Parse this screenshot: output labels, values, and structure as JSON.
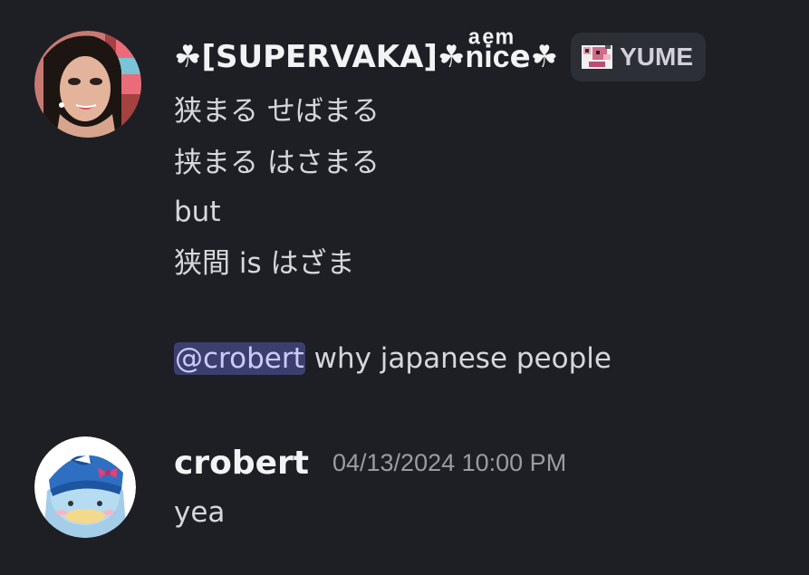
{
  "messages": [
    {
      "username": "☘[SUPERVAKA]☘nͣiͤcͫe☘",
      "role_tag": "YUME",
      "lines": [
        "狭まる せばまる",
        "挟まる はさまる",
        "but",
        "狭間 is はざま"
      ],
      "mention": "@crobert",
      "mention_text": " why japanese people"
    },
    {
      "username": "crobert",
      "timestamp": "04/13/2024 10:00 PM",
      "lines": [
        "yea"
      ]
    }
  ],
  "icons": {
    "role_icon": "pixel-pig-icon",
    "avatar1": "avatar-photo",
    "avatar2": "avatar-penguin"
  },
  "colors": {
    "background": "#1e1f24",
    "mention_bg": "#3c3f6e",
    "mention_fg": "#c9cdfb",
    "role_tag_bg": "#2d2f36"
  }
}
